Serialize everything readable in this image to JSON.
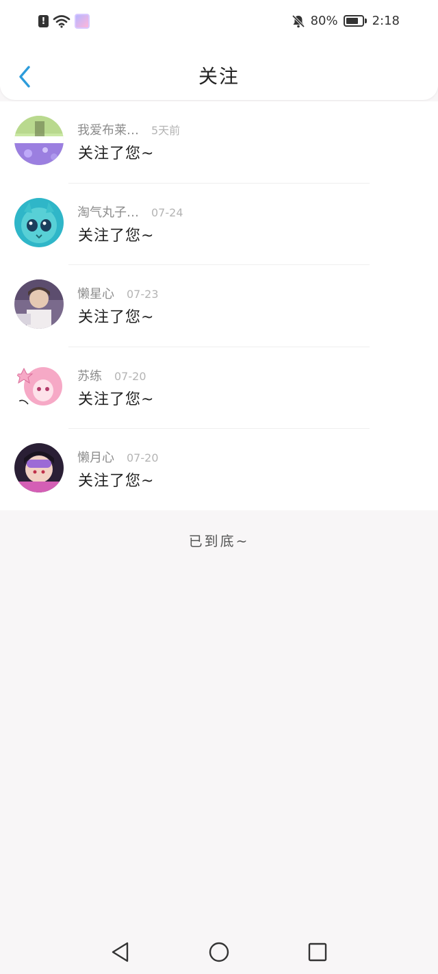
{
  "status_bar": {
    "battery_percent": "80%",
    "time": "2:18"
  },
  "header": {
    "title": "关注"
  },
  "follow_list": [
    {
      "name": "我爱布莱…",
      "time": "5天前",
      "action": "关注了您~"
    },
    {
      "name": "淘气丸子…",
      "time": "07-24",
      "action": "关注了您~"
    },
    {
      "name": "懒星心",
      "time": "07-23",
      "action": "关注了您~"
    },
    {
      "name": "苏练",
      "time": "07-20",
      "action": "关注了您~"
    },
    {
      "name": "懒月心",
      "time": "07-20",
      "action": "关注了您~"
    }
  ],
  "footer": {
    "end_text": "已到底~"
  },
  "icons": {
    "back": "chevron-left-icon",
    "nav_back": "triangle-back-icon",
    "nav_home": "circle-home-icon",
    "nav_recents": "square-recents-icon"
  },
  "colors": {
    "accent": "#2d9cdb",
    "background": "#f8f6f7"
  }
}
